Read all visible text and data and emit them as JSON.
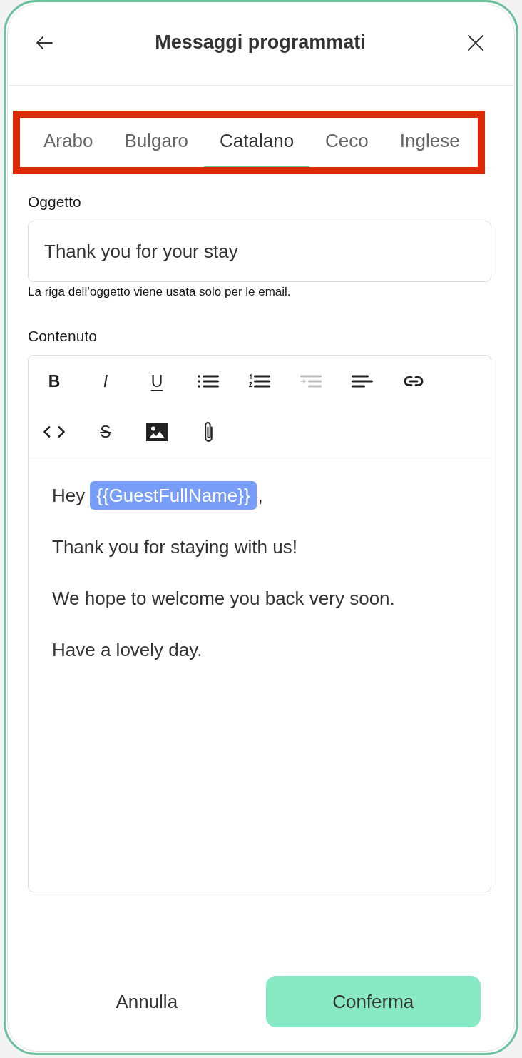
{
  "header": {
    "title": "Messaggi programmati"
  },
  "tabs": {
    "highlighted": true,
    "items": [
      {
        "label": "Arabo",
        "selected": false
      },
      {
        "label": "Bulgaro",
        "selected": false
      },
      {
        "label": "Catalano",
        "selected": true
      },
      {
        "label": "Ceco",
        "selected": false
      },
      {
        "label": "Inglese",
        "selected": false
      }
    ]
  },
  "subject": {
    "label": "Oggetto",
    "value": "Thank you for your stay",
    "hint": "La riga dell’oggetto viene usata solo per le email."
  },
  "content": {
    "label": "Contenuto",
    "toolbar": [
      {
        "kind": "bold",
        "label": "B",
        "disabled": false
      },
      {
        "kind": "italic",
        "label": "I",
        "disabled": false
      },
      {
        "kind": "underline",
        "label": "U",
        "disabled": false
      },
      {
        "kind": "bullet-list",
        "disabled": false
      },
      {
        "kind": "numbered-list",
        "disabled": false
      },
      {
        "kind": "indent",
        "disabled": true
      },
      {
        "kind": "align",
        "disabled": false
      },
      {
        "kind": "link",
        "disabled": false
      },
      {
        "kind": "code",
        "disabled": false
      },
      {
        "kind": "strike",
        "label": "S",
        "disabled": false
      },
      {
        "kind": "image",
        "disabled": false
      },
      {
        "kind": "attachment",
        "disabled": false
      }
    ],
    "paragraphs": [
      {
        "parts": [
          {
            "kind": "text",
            "text": "Hey"
          },
          {
            "kind": "variable",
            "text": "{{GuestFullName}}"
          },
          {
            "kind": "text",
            "text": ","
          }
        ]
      },
      {
        "parts": [
          {
            "kind": "text",
            "text": "Thank you for staying with us!"
          }
        ]
      },
      {
        "parts": [
          {
            "kind": "text",
            "text": "We hope to welcome you back very soon."
          }
        ]
      },
      {
        "parts": [
          {
            "kind": "text",
            "text": "Have a lovely day."
          }
        ]
      }
    ]
  },
  "buttons": [
    {
      "kind": "secondary",
      "label": "Annulla"
    },
    {
      "kind": "primary",
      "label": "Conferma"
    }
  ]
}
